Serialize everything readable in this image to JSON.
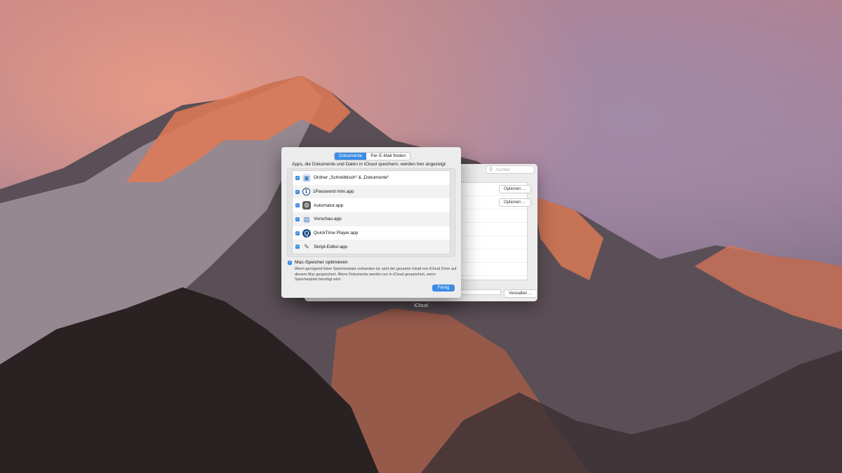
{
  "background_window": {
    "search_placeholder": "Suchen",
    "options_buttons": [
      "Optionen …",
      "Optionen …"
    ],
    "manage_button": "Verwalten …",
    "title": "iCloud"
  },
  "sheet": {
    "tabs": [
      {
        "label": "Dokumente",
        "selected": true
      },
      {
        "label": "Per E-Mail finden",
        "selected": false
      }
    ],
    "heading": "Apps, die Dokumente und Daten in iCloud speichern, werden hier angezeigt:",
    "apps": [
      {
        "label": "Ordner „Schreibtisch“ & „Dokumente“",
        "checked": true,
        "icon": "folder-icon"
      },
      {
        "label": "1Password mini.app",
        "checked": true,
        "icon": "1password-icon"
      },
      {
        "label": "Automator.app",
        "checked": true,
        "icon": "automator-icon"
      },
      {
        "label": "Vorschau.app",
        "checked": true,
        "icon": "preview-icon"
      },
      {
        "label": "QuickTime Player.app",
        "checked": true,
        "icon": "quicktime-icon"
      },
      {
        "label": "Skript-Editor.app",
        "checked": true,
        "icon": "script-editor-icon"
      }
    ],
    "optimize": {
      "label": "Mac-Speicher optimieren",
      "checked": true,
      "description": "Wenn genügend freier Speicherplatz vorhanden ist, wird der gesamte Inhalt von iCloud Drive auf diesem Mac gespeichert. Ältere Dokumente werden nur in iCloud gespeichert, wenn Speicherplatz benötigt wird."
    },
    "done_button": "Fertig"
  },
  "colors": {
    "accent": "#3c8ce7",
    "window": "#ececec"
  }
}
